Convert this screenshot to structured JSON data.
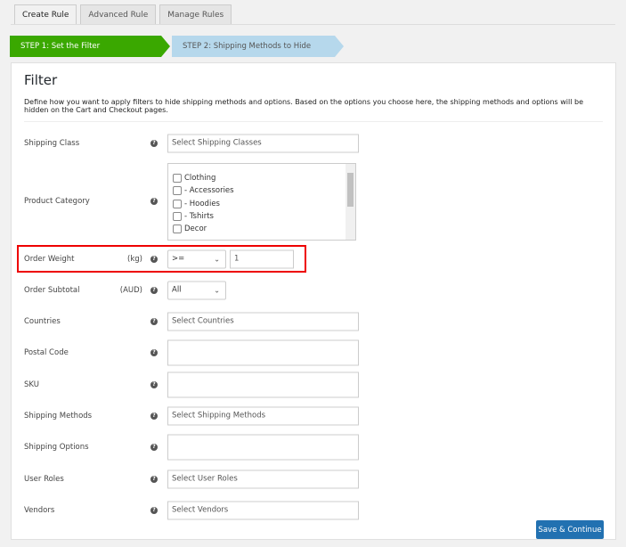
{
  "tabs": [
    "Create Rule",
    "Advanced Rule",
    "Manage Rules"
  ],
  "steps": [
    "STEP 1: Set the Filter",
    "STEP 2: Shipping Methods to Hide"
  ],
  "title": "Filter",
  "description": "Define how you want to apply filters to hide shipping methods and options. Based on the options you choose here, the shipping methods and options will be hidden on the Cart and Checkout pages.",
  "fields": {
    "shipping_class": {
      "label": "Shipping Class",
      "placeholder": "Select Shipping Classes"
    },
    "product_category": {
      "label": "Product Category",
      "options": [
        "Clothing",
        "- Accessories",
        "- Hoodies",
        "- Tshirts",
        "Decor"
      ]
    },
    "order_weight": {
      "label": "Order Weight",
      "unit": "(kg)",
      "operator": ">=",
      "value": "1"
    },
    "order_subtotal": {
      "label": "Order Subtotal",
      "unit": "(AUD)",
      "value": "All"
    },
    "countries": {
      "label": "Countries",
      "placeholder": "Select Countries"
    },
    "postal_code": {
      "label": "Postal Code"
    },
    "sku": {
      "label": "SKU"
    },
    "shipping_methods": {
      "label": "Shipping Methods",
      "placeholder": "Select Shipping Methods"
    },
    "shipping_options": {
      "label": "Shipping Options"
    },
    "user_roles": {
      "label": "User Roles",
      "placeholder": "Select User Roles"
    },
    "vendors": {
      "label": "Vendors",
      "placeholder": "Select Vendors"
    }
  },
  "help_glyph": "?",
  "save_label": "Save & Continue",
  "colors": {
    "step_active": "#3aa800",
    "step_inactive": "#b6d8ec",
    "highlight": "#e00000",
    "primary": "#2271b1"
  }
}
